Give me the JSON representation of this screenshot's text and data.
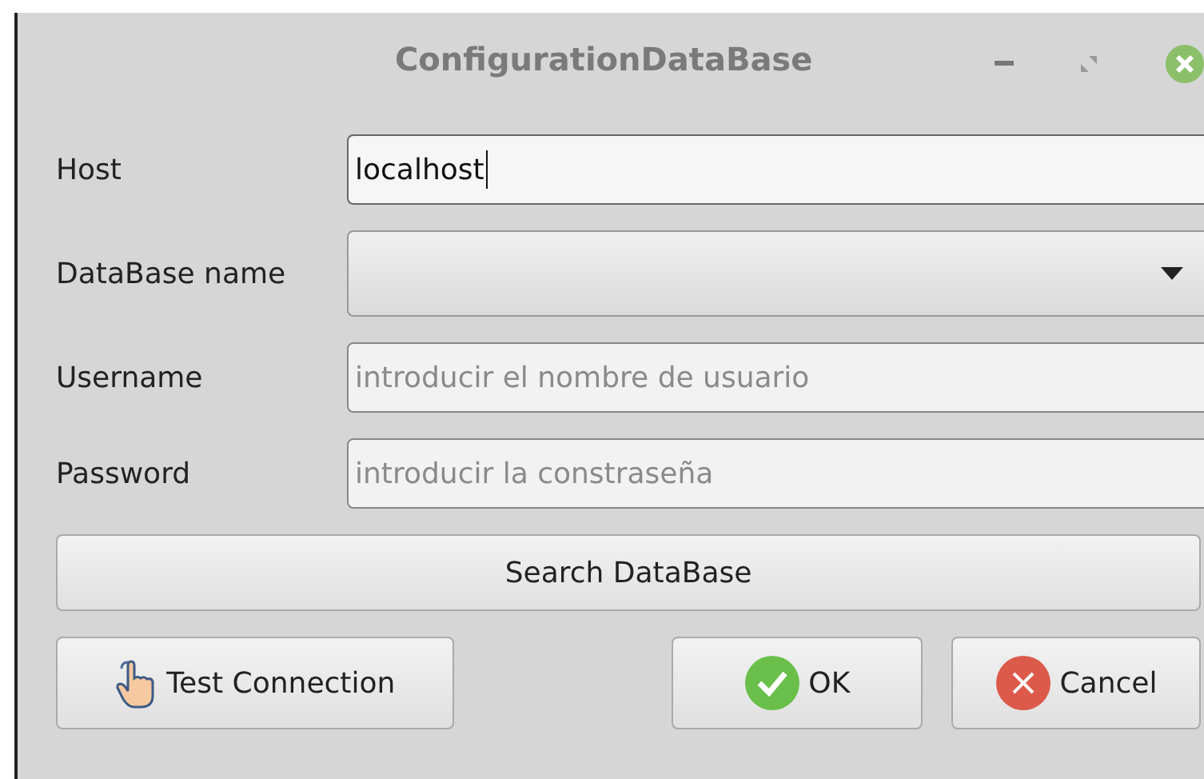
{
  "window": {
    "title": "ConfigurationDataBase"
  },
  "fields": [
    {
      "kind": "text",
      "label": "Host",
      "value": "localhost",
      "focused": true
    },
    {
      "kind": "combo",
      "label": "DataBase name"
    },
    {
      "kind": "text",
      "label": "Username",
      "placeholder": "introducir el nombre de usuario",
      "focused": false
    },
    {
      "kind": "text",
      "label": "Password",
      "placeholder": "introducir la constraseña",
      "focused": false
    }
  ],
  "search_button": "Search DataBase",
  "buttons": [
    {
      "kind": "test",
      "label": "Test Connection"
    },
    {
      "kind": "ok",
      "label": "OK"
    },
    {
      "kind": "cancel",
      "label": "Cancel"
    }
  ]
}
